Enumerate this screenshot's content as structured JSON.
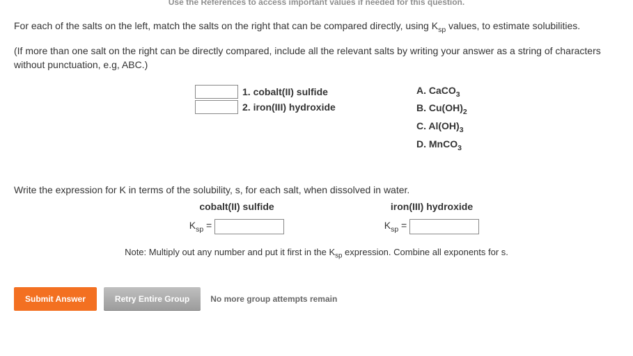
{
  "top_hint": "Use the References to access important values if needed for this question.",
  "question": {
    "part1_prefix": "For each of the salts on the left, match the salts on the right that can be compared directly, using K",
    "part1_sub": "sp",
    "part1_suffix": " values, to estimate solubilities.",
    "instruction": "(If more than one salt on the right can be directly compared, include all the relevant salts by writing your answer as a string of characters without punctuation, e.g, ABC.)"
  },
  "matches": [
    {
      "label": "1. cobalt(II) sulfide"
    },
    {
      "label": "2. iron(III) hydroxide"
    }
  ],
  "options": [
    {
      "prefix": "A. CaCO",
      "sub": "3"
    },
    {
      "prefix": "B. Cu(OH)",
      "sub": "2"
    },
    {
      "prefix": "C. Al(OH)",
      "sub": "3"
    },
    {
      "prefix": "D. MnCO",
      "sub": "3"
    }
  ],
  "section2": {
    "prompt": "Write the expression for K in terms of the solubility, s, for each salt, when dissolved in water.",
    "columns": [
      {
        "header": "cobalt(II) sulfide"
      },
      {
        "header": "iron(III) hydroxide"
      }
    ],
    "ksp_label_prefix": "K",
    "ksp_label_sub": "sp",
    "ksp_label_suffix": " =",
    "note_prefix": "Note: Multiply out any number and put it first in the K",
    "note_sub": "sp",
    "note_suffix": " expression. Combine all exponents for s."
  },
  "buttons": {
    "submit": "Submit Answer",
    "retry": "Retry Entire Group",
    "attempts_msg": "No more group attempts remain"
  }
}
